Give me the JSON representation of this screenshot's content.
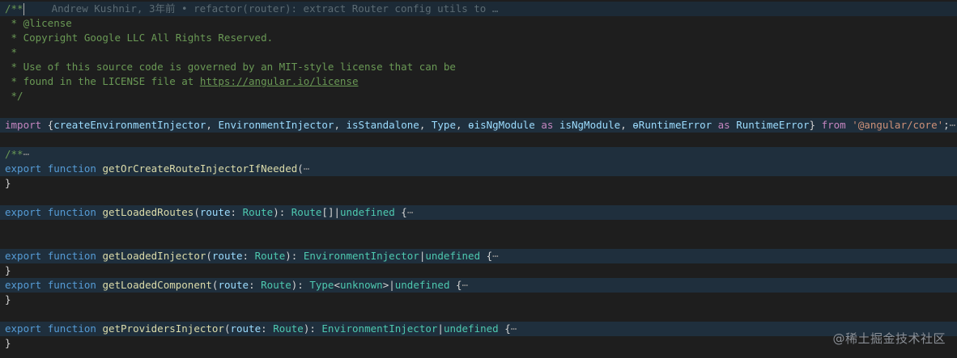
{
  "editor": {
    "blame": "Andrew Kushnir, 3年前 • refactor(router): extract Router config utils to …",
    "license": {
      "open": "/**",
      "tag": " * @license",
      "copyright": " * Copyright Google LLC All Rights Reserved.",
      "blank": " *",
      "use1": " * Use of this source code is governed by an MIT-style license that can be",
      "found": " * found in the LICENSE file at ",
      "url": "https://angular.io/license",
      "close": " */"
    },
    "import": {
      "kw": "import",
      "open": " {",
      "n1": "createEnvironmentInjector",
      "n2": "EnvironmentInjector",
      "n3": "isStandalone",
      "n4": "Type",
      "n5": "ɵisNgModule",
      "as1": " as ",
      "n6": "isNgModule",
      "n7": "ɵRuntimeError",
      "as2": " as ",
      "n8": "RuntimeError",
      "close": "} ",
      "from": "from",
      "module": "'@angular/core'",
      "semi": ";",
      "fold": "⋯"
    },
    "doc_fold": {
      "open": "/**",
      "fold": "⋯"
    },
    "functions": [
      {
        "export": "export",
        "function": "function",
        "name": "getOrCreateRouteInjectorIfNeeded",
        "param": "",
        "ptype": "",
        "sig_rest": "",
        "fold": "⋯",
        "close": "}"
      },
      {
        "export": "export",
        "function": "function",
        "name": "getLoadedRoutes",
        "param": "route",
        "ptype": "Route",
        "ret": "Route",
        "ret_suffix": "[]",
        "pipe": "|",
        "undef": "undefined",
        "brace": " {",
        "fold": "⋯"
      },
      {
        "export": "export",
        "function": "function",
        "name": "getLoadedInjector",
        "param": "route",
        "ptype": "Route",
        "ret": "EnvironmentInjector",
        "pipe": "|",
        "undef": "undefined",
        "brace": " {",
        "fold": "⋯",
        "close": "}"
      },
      {
        "export": "export",
        "function": "function",
        "name": "getLoadedComponent",
        "param": "route",
        "ptype": "Route",
        "ret": "Type",
        "generic_open": "<",
        "generic": "unknown",
        "generic_close": ">",
        "pipe": "|",
        "undef": "undefined",
        "brace": " {",
        "fold": "⋯",
        "close": "}"
      },
      {
        "export": "export",
        "function": "function",
        "name": "getProvidersInjector",
        "param": "route",
        "ptype": "Route",
        "ret": "EnvironmentInjector",
        "pipe": "|",
        "undef": "undefined",
        "brace": " {",
        "fold": "⋯",
        "close": "}"
      }
    ]
  },
  "watermark": "@稀土掘金技术社区"
}
